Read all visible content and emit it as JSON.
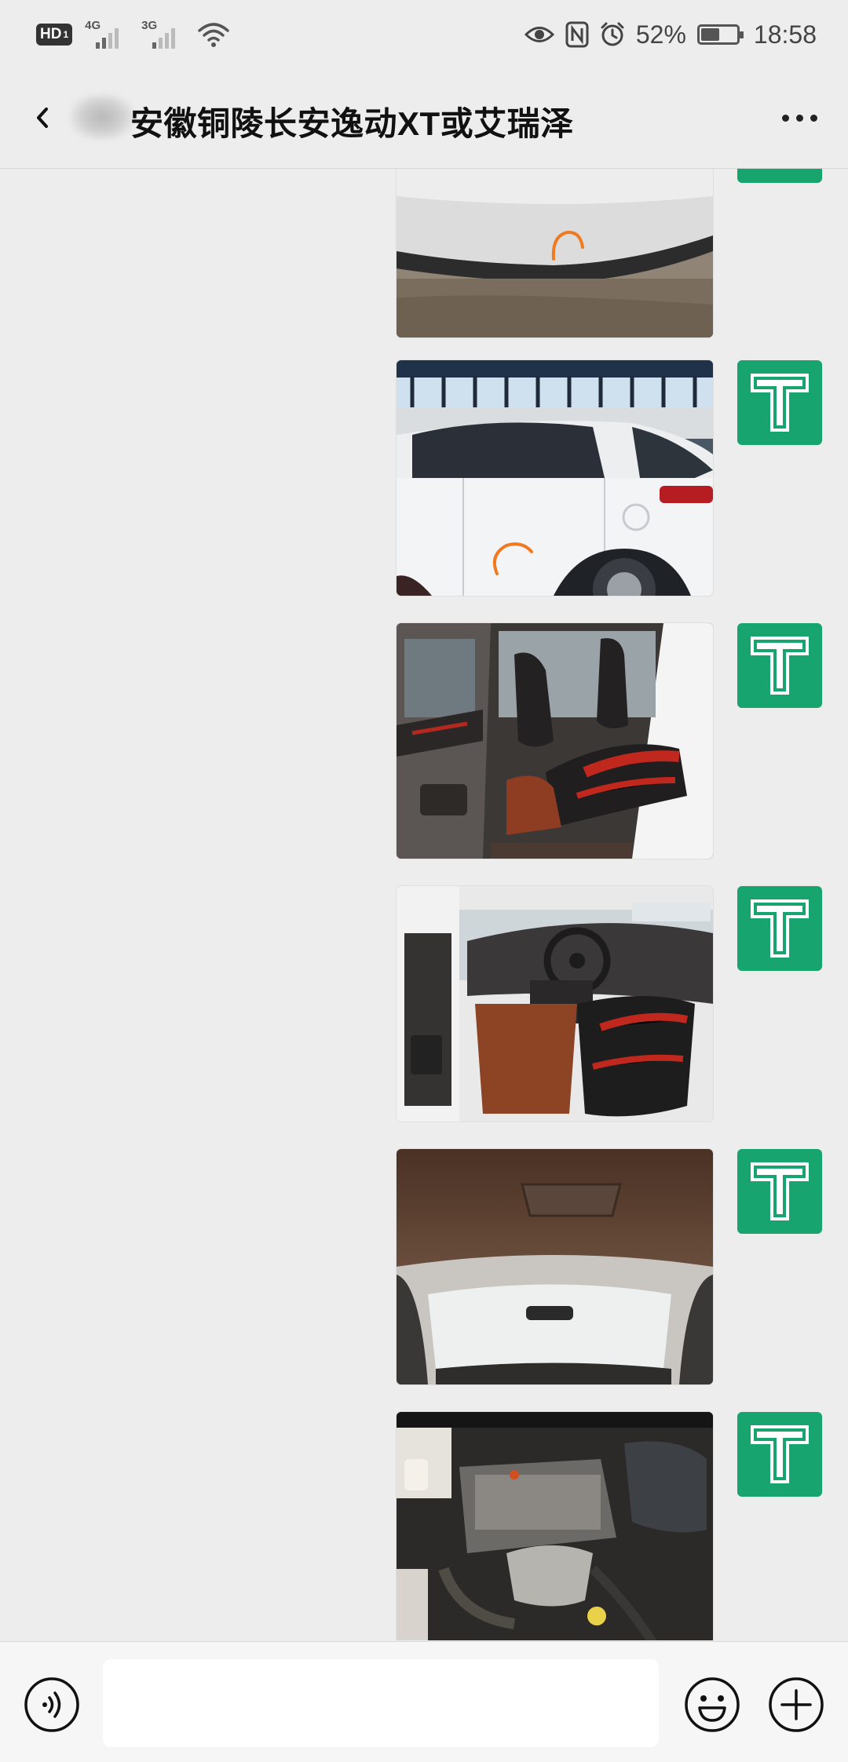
{
  "status_bar": {
    "hd_label": "HD",
    "hd_sub": "1",
    "net1_label": "4G",
    "net2_label": "3G",
    "battery_text": "52%",
    "battery_level": 0.52,
    "time": "18:58",
    "icons": [
      "eye-icon",
      "nfc-icon",
      "alarm-icon",
      "battery-icon",
      "wifi-icon"
    ]
  },
  "nav": {
    "title": "安徽铜陵长安逸动XT或艾瑞泽",
    "back_icon": "chevron-left-icon",
    "more_icon": "more-icon"
  },
  "messages": [
    {
      "type": "image",
      "subject": "rear bumper",
      "sender": "self"
    },
    {
      "type": "image",
      "subject": "side view white car",
      "sender": "self"
    },
    {
      "type": "image",
      "subject": "rear seats interior",
      "sender": "self"
    },
    {
      "type": "image",
      "subject": "front cabin interior",
      "sender": "self"
    },
    {
      "type": "image",
      "subject": "headliner and windshield",
      "sender": "self"
    },
    {
      "type": "image",
      "subject": "engine bay",
      "sender": "self"
    }
  ],
  "input_bar": {
    "voice_icon": "voice-icon",
    "input_value": "",
    "emoji_icon": "emoji-icon",
    "plus_icon": "plus-icon"
  },
  "colors": {
    "background": "#ededed",
    "avatar_green": "#18a46f",
    "input_bar": "#f6f6f6"
  }
}
